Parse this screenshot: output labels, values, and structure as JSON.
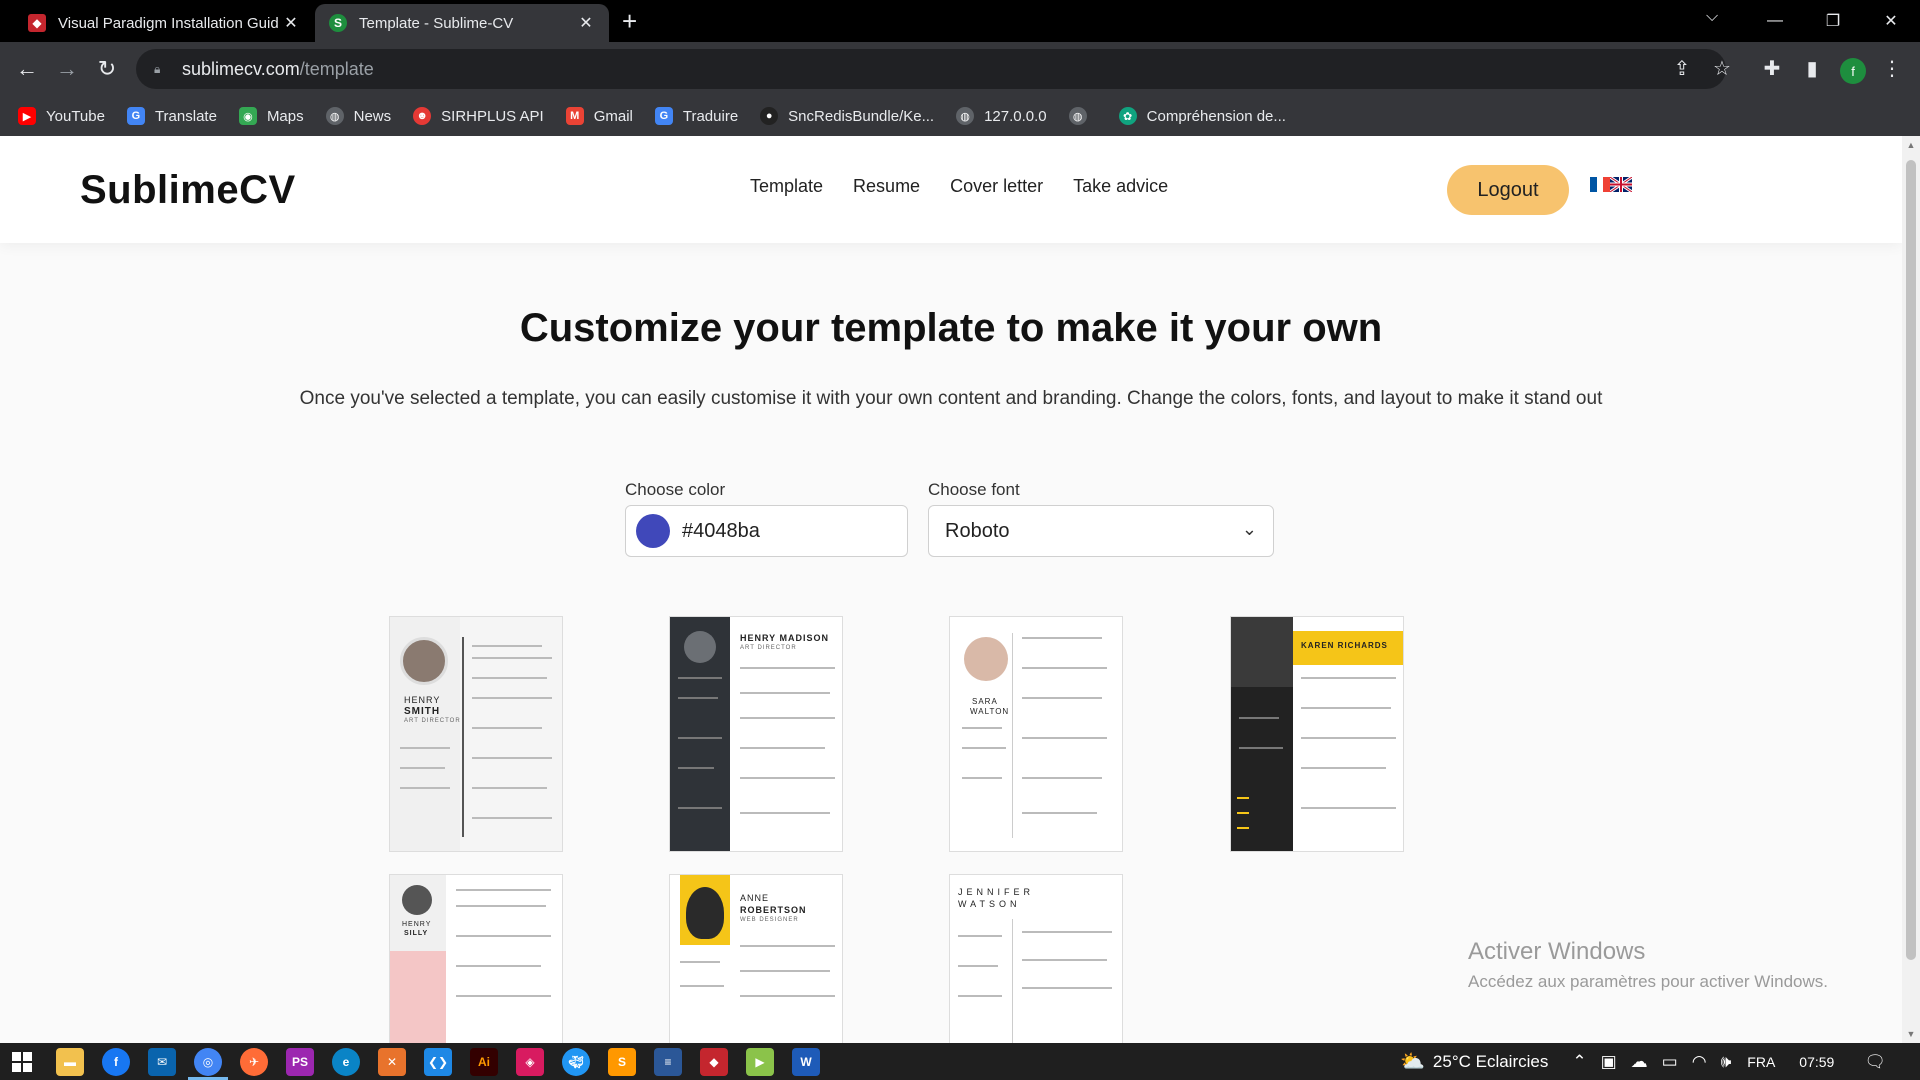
{
  "browser": {
    "tabs": [
      {
        "title": "Visual Paradigm Installation Guid",
        "active": false,
        "favicon_color": "#c4262e"
      },
      {
        "title": "Template - Sublime-CV",
        "active": true,
        "favicon_color": "#1e8e3e",
        "favicon_letter": "S"
      }
    ],
    "url_domain": "sublimecv.com",
    "url_path": "/template",
    "profile_letter": "f",
    "bookmarks": [
      {
        "label": "YouTube",
        "color": "#ff0000"
      },
      {
        "label": "Translate",
        "color": "#4285f4"
      },
      {
        "label": "Maps",
        "color": "#34a853"
      },
      {
        "label": "News",
        "color": "#5f6368"
      },
      {
        "label": "SIRHPLUS API",
        "color": "#e53935"
      },
      {
        "label": "Gmail",
        "color": "#ea4335"
      },
      {
        "label": "Traduire",
        "color": "#4285f4"
      },
      {
        "label": "SncRedisBundle/Ke...",
        "color": "#222222"
      },
      {
        "label": "127.0.0.0",
        "color": "#5f6368"
      },
      {
        "label": "",
        "color": "#5f6368"
      },
      {
        "label": "Compréhension de...",
        "color": "#10a37f"
      }
    ]
  },
  "site": {
    "logo": "SublimeCV",
    "nav": [
      "Template",
      "Resume",
      "Cover letter",
      "Take advice"
    ],
    "logout_label": "Logout",
    "headline": "Customize your template to make it your own",
    "subline": "Once you've selected a template, you can easily customise it with your own content and branding. Change the colors, fonts, and layout to make it stand out",
    "color_label": "Choose color",
    "color_value": "#4048ba",
    "font_label": "Choose font",
    "font_value": "Roboto",
    "accent_button": "#f7c36e"
  },
  "templates": [
    {
      "name_line1": "HENRY",
      "name_line2": "SMITH",
      "role": "ART DIRECTOR"
    },
    {
      "name_line1": "HENRY MADISON",
      "name_line2": "",
      "role": "ART DIRECTOR"
    },
    {
      "name_line1": "SARA",
      "name_line2": "WALTON",
      "role": ""
    },
    {
      "name_line1": "KAREN RICHARDS",
      "name_line2": "",
      "role": ""
    },
    {
      "name_line1": "HENRY",
      "name_line2": "SILLY",
      "role": ""
    },
    {
      "name_line1": "ANNE",
      "name_line2": "ROBERTSON",
      "role": "WEB DESIGNER"
    },
    {
      "name_line1": "JENNIFER",
      "name_line2": "WATSON",
      "role": ""
    }
  ],
  "windows_watermark": {
    "title": "Activer Windows",
    "subtitle": "Accédez aux paramètres pour activer Windows."
  },
  "taskbar": {
    "weather": "25°C  Eclaircies",
    "language": "FRA",
    "time": "07:59"
  }
}
